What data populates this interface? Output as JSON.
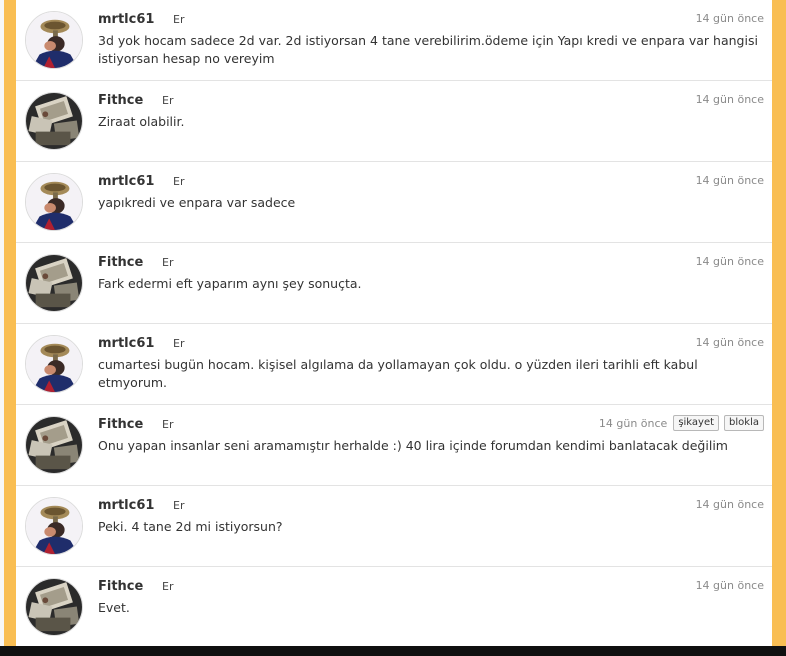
{
  "messages": [
    {
      "user": "mrtlc61",
      "gender": "Er",
      "time": "14 gün önce",
      "avatar": "avatar-mrtlc61",
      "text": "3d yok hocam sadece 2d var. 2d istiyorsan 4 tane verebilirim.ödeme için Yapı kredi ve enpara var hangisi istiyorsan hesap no vereyim"
    },
    {
      "user": "Fithce",
      "gender": "Er",
      "time": "14 gün önce",
      "avatar": "avatar-fithce",
      "text": "Ziraat olabilir."
    },
    {
      "user": "mrtlc61",
      "gender": "Er",
      "time": "14 gün önce",
      "avatar": "avatar-mrtlc61",
      "text": "yapıkredi ve enpara var sadece"
    },
    {
      "user": "Fithce",
      "gender": "Er",
      "time": "14 gün önce",
      "avatar": "avatar-fithce",
      "text": "Fark edermi eft yaparım aynı şey sonuçta."
    },
    {
      "user": "mrtlc61",
      "gender": "Er",
      "time": "14 gün önce",
      "avatar": "avatar-mrtlc61",
      "text": "cumartesi bugün hocam. kişisel algılama da yollamayan çok oldu. o yüzden ileri tarihli eft kabul etmyorum."
    },
    {
      "user": "Fithce",
      "gender": "Er",
      "time": "14 gün önce",
      "avatar": "avatar-fithce",
      "text": "Onu yapan insanlar seni aramamıştır herhalde :) 40 lira içinde forumdan kendimi banlatacak değilim",
      "actions": {
        "report": "şikayet",
        "block": "blokla"
      }
    },
    {
      "user": "mrtlc61",
      "gender": "Er",
      "time": "14 gün önce",
      "avatar": "avatar-mrtlc61",
      "text": "Peki. 4 tane 2d mi istiyorsun?"
    },
    {
      "user": "Fithce",
      "gender": "Er",
      "time": "14 gün önce",
      "avatar": "avatar-fithce",
      "text": "Evet."
    }
  ]
}
